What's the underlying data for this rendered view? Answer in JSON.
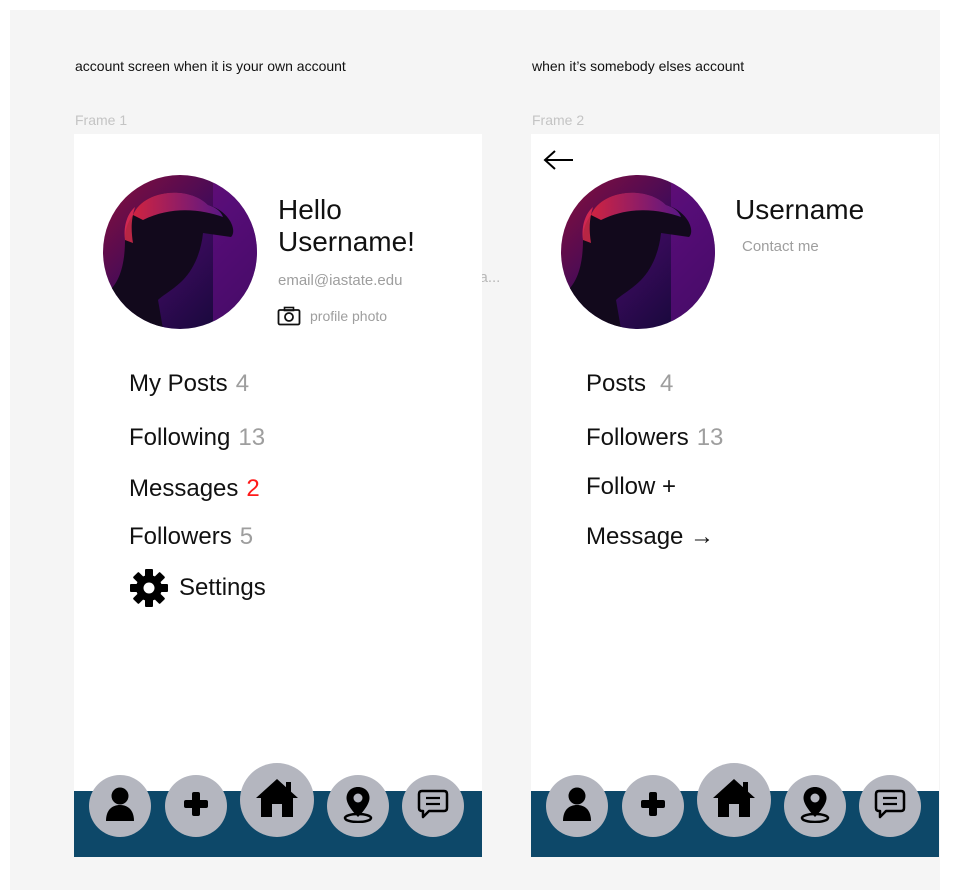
{
  "captions": {
    "left": "account screen when it is your own account",
    "right": "when it’s somebody elses account"
  },
  "frames": {
    "f1_label": "Frame 1",
    "f2_label": "Frame 2"
  },
  "overflow_text": "ma...",
  "own_account": {
    "greeting": "Hello",
    "username": "Username!",
    "email": "email@iastate.edu",
    "profile_photo_label": "profile photo",
    "menu": [
      {
        "label": "My Posts",
        "count": "4",
        "count_color": "#9e9e9e"
      },
      {
        "label": "Following",
        "count": "13",
        "count_color": "#9e9e9e"
      },
      {
        "label": "Messages",
        "count": "2",
        "count_color": "#ff1a1a"
      },
      {
        "label": "Followers",
        "count": "5",
        "count_color": "#9e9e9e"
      }
    ],
    "settings_label": "Settings"
  },
  "other_account": {
    "username": "Username",
    "contact": "Contact me",
    "posts_label": "Posts",
    "posts_count": "4",
    "followers_label": "Followers",
    "followers_count": "13",
    "follow_label": "Follow +",
    "message_label": "Message →"
  },
  "nav": {
    "bar_color": "#0d4869",
    "button_color": "#b4b6bf",
    "icons": [
      "person-icon",
      "plus-icon",
      "home-icon",
      "location-pin-icon",
      "chat-icon"
    ]
  }
}
